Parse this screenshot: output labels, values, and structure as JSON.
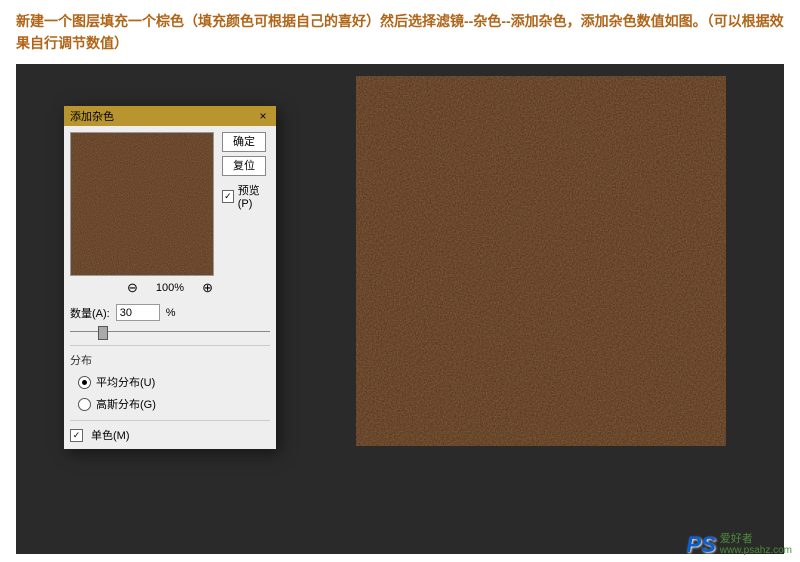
{
  "description": "新建一个图层填充一个棕色（填充颜色可根据自己的喜好）然后选择滤镜--杂色--添加杂色，添加杂色数值如图。（可以根据效果自行调节数值）",
  "dialog": {
    "title": "添加杂色",
    "close": "×",
    "ok": "确定",
    "cancel": "复位",
    "preview_label": "预览(P)",
    "zoom": "100%",
    "amount_label": "数量(A):",
    "amount_value": "30",
    "amount_unit": "%",
    "dist_label": "分布",
    "dist_uniform": "平均分布(U)",
    "dist_gaussian": "高斯分布(G)",
    "mono": "单色(M)"
  },
  "watermark": {
    "logo": "PS",
    "name": "爱好者",
    "url": "www.psahz.com"
  },
  "colors": {
    "brown1": "#3e2418",
    "brown2": "#7a4a2c",
    "brown3": "#b07040"
  }
}
